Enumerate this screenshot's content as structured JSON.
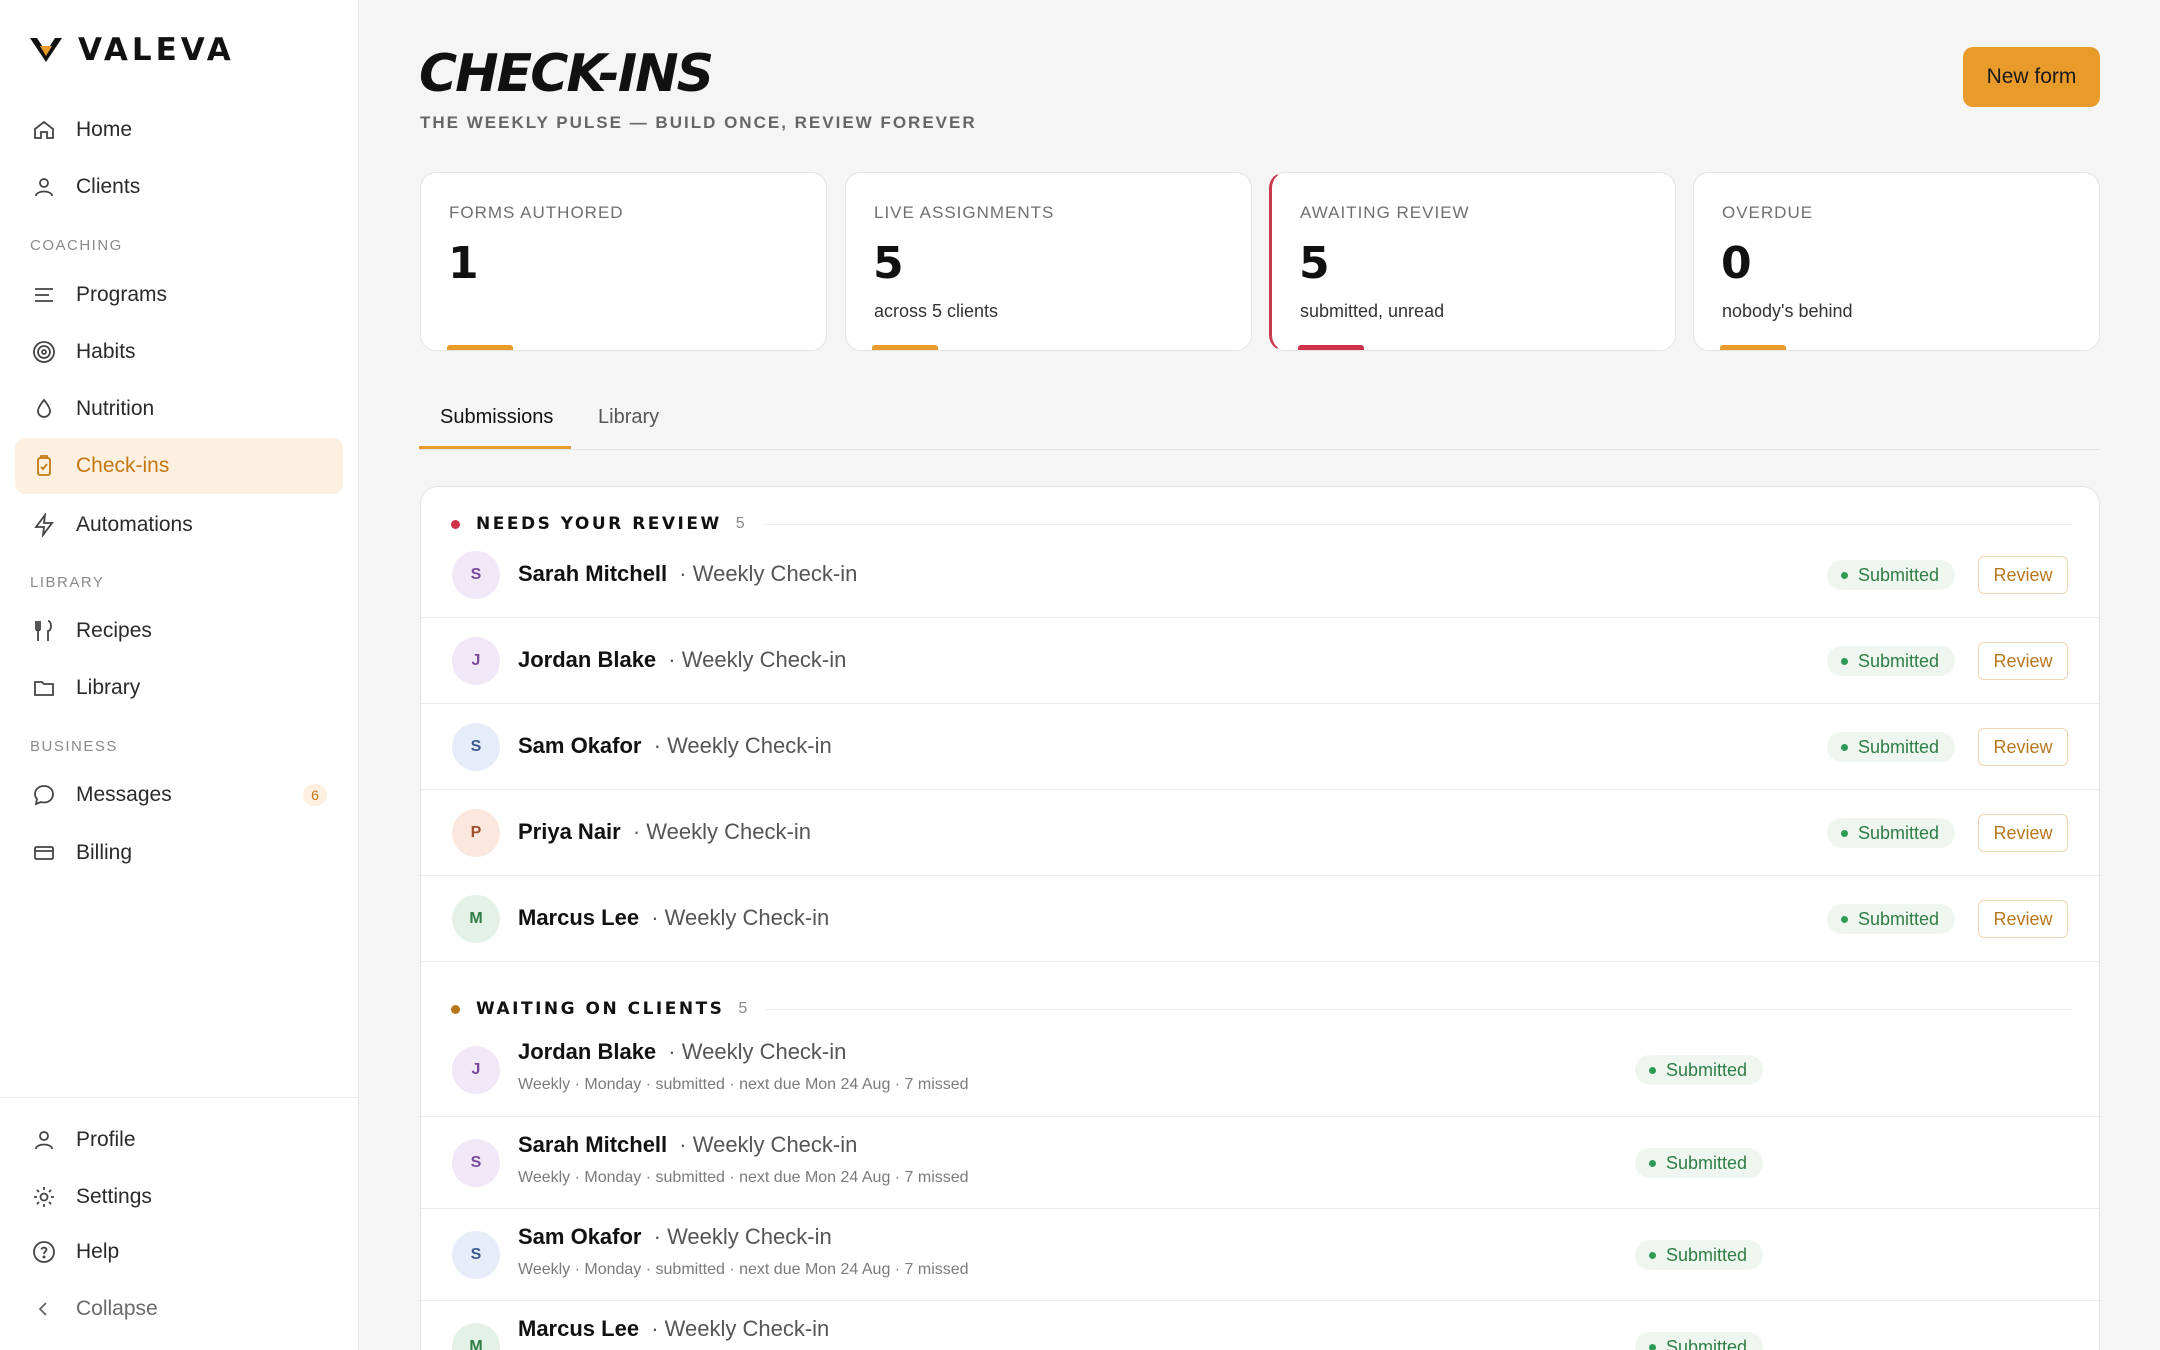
{
  "brand": {
    "name": "VALEVA"
  },
  "sidebar": {
    "items": [
      {
        "label": "Home"
      },
      {
        "label": "Clients"
      },
      {
        "label": "Programs"
      },
      {
        "label": "Habits"
      },
      {
        "label": "Nutrition"
      },
      {
        "label": "Check-ins"
      },
      {
        "label": "Automations"
      },
      {
        "label": "Recipes"
      },
      {
        "label": "Library"
      },
      {
        "label": "Messages",
        "badge": "6"
      },
      {
        "label": "Billing"
      }
    ],
    "sections": {
      "coaching": "COACHING",
      "library": "LIBRARY",
      "business": "BUSINESS"
    },
    "footer": {
      "profile": "Profile",
      "settings": "Settings",
      "help": "Help",
      "collapse": "Collapse"
    }
  },
  "header": {
    "title": "CHECK-INS",
    "subtitle": "THE WEEKLY PULSE — BUILD ONCE, REVIEW FOREVER",
    "new_form_label": "New form"
  },
  "stats": [
    {
      "label": "FORMS AUTHORED",
      "value": "1",
      "sub": ""
    },
    {
      "label": "LIVE ASSIGNMENTS",
      "value": "5",
      "sub": "across 5 clients"
    },
    {
      "label": "AWAITING REVIEW",
      "value": "5",
      "sub": "submitted, unread"
    },
    {
      "label": "OVERDUE",
      "value": "0",
      "sub": "nobody's behind"
    }
  ],
  "tabs": [
    {
      "label": "Submissions"
    },
    {
      "label": "Library"
    }
  ],
  "needs_review": {
    "title": "NEEDS YOUR REVIEW",
    "count": "5",
    "rows": [
      {
        "initial": "S",
        "name": "Sarah Mitchell",
        "form": "· Weekly Check-in",
        "status": "Submitted",
        "action": "Review"
      },
      {
        "initial": "J",
        "name": "Jordan Blake",
        "form": "· Weekly Check-in",
        "status": "Submitted",
        "action": "Review"
      },
      {
        "initial": "S",
        "name": "Sam Okafor",
        "form": "· Weekly Check-in",
        "status": "Submitted",
        "action": "Review"
      },
      {
        "initial": "P",
        "name": "Priya Nair",
        "form": "· Weekly Check-in",
        "status": "Submitted",
        "action": "Review"
      },
      {
        "initial": "M",
        "name": "Marcus Lee",
        "form": "· Weekly Check-in",
        "status": "Submitted",
        "action": "Review"
      }
    ]
  },
  "waiting": {
    "title": "WAITING ON CLIENTS",
    "count": "5",
    "rows": [
      {
        "initial": "J",
        "name": "Jordan Blake",
        "form": "· Weekly Check-in",
        "meta": "Weekly · Monday · submitted · next due Mon 24 Aug · 7 missed",
        "status": "Submitted"
      },
      {
        "initial": "S",
        "name": "Sarah Mitchell",
        "form": "· Weekly Check-in",
        "meta": "Weekly · Monday · submitted · next due Mon 24 Aug · 7 missed",
        "status": "Submitted"
      },
      {
        "initial": "S",
        "name": "Sam Okafor",
        "form": "· Weekly Check-in",
        "meta": "Weekly · Monday · submitted · next due Mon 24 Aug · 7 missed",
        "status": "Submitted"
      },
      {
        "initial": "M",
        "name": "Marcus Lee",
        "form": "· Weekly Check-in",
        "meta": "",
        "status": "Submitted"
      }
    ]
  },
  "colors": {
    "accent": "#e89b2b",
    "accent_text": "#c57811",
    "alert": "#d0324a",
    "status_green": "#2f7d46"
  }
}
